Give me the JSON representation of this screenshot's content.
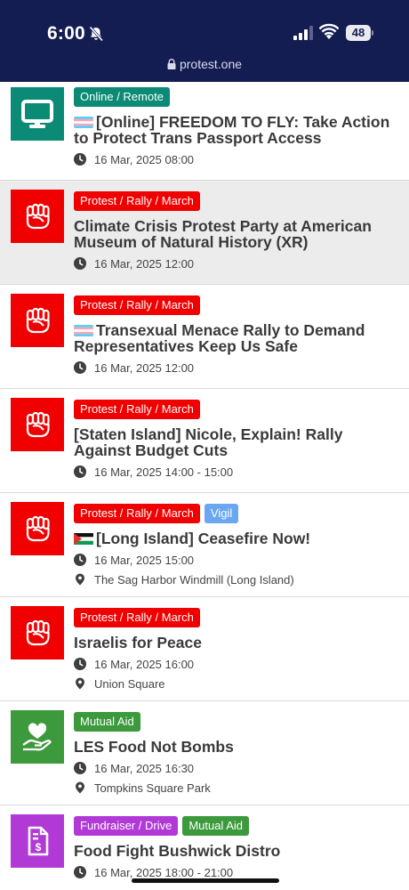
{
  "status": {
    "time": "6:00",
    "battery": "48"
  },
  "browser": {
    "url": "protest.one"
  },
  "colors": {
    "status_bg": "#141d52",
    "online": "#0b8a75",
    "protest": "#f00000",
    "vigil": "#6aa7f0",
    "mutual_aid": "#3c9a3c",
    "fundraiser": "#b13ad6"
  },
  "events": [
    {
      "tags": [
        "Online / Remote"
      ],
      "title": "[Online] FREEDOM TO FLY: Take Action to Protect Trans Passport Access",
      "flag": "trans-flag",
      "icon": "monitor-icon",
      "when": "16 Mar, 2025 08:00"
    },
    {
      "tags": [
        "Protest / Rally / March"
      ],
      "title": "Climate Crisis Protest Party at American Museum of Natural History (XR)",
      "icon": "fist-icon",
      "when": "16 Mar, 2025 12:00"
    },
    {
      "tags": [
        "Protest / Rally / March"
      ],
      "title": "Transexual Menace Rally to Demand Representatives Keep Us Safe",
      "flag": "trans-flag",
      "icon": "fist-icon",
      "when": "16 Mar, 2025 12:00"
    },
    {
      "tags": [
        "Protest / Rally / March"
      ],
      "title": "[Staten Island] Nicole, Explain! Rally Against Budget Cuts",
      "icon": "fist-icon",
      "when": "16 Mar, 2025 14:00 - 15:00"
    },
    {
      "tags": [
        "Protest / Rally / March",
        "Vigil"
      ],
      "title": "[Long Island] Ceasefire Now!",
      "flag": "palestine-flag",
      "icon": "fist-icon",
      "when": "16 Mar, 2025 15:00",
      "where": "The Sag Harbor Windmill (Long Island)"
    },
    {
      "tags": [
        "Protest / Rally / March"
      ],
      "title": "Israelis for Peace",
      "icon": "fist-icon",
      "when": "16 Mar, 2025 16:00",
      "where": "Union Square"
    },
    {
      "tags": [
        "Mutual Aid"
      ],
      "title": "LES Food Not Bombs",
      "icon": "heart-hand-icon",
      "when": "16 Mar, 2025 16:30",
      "where": "Tompkins Square Park"
    },
    {
      "tags": [
        "Fundraiser / Drive",
        "Mutual Aid"
      ],
      "title": "Food Fight Bushwick Distro",
      "icon": "dollar-doc-icon",
      "when": "16 Mar, 2025 18:00 - 21:00"
    }
  ]
}
